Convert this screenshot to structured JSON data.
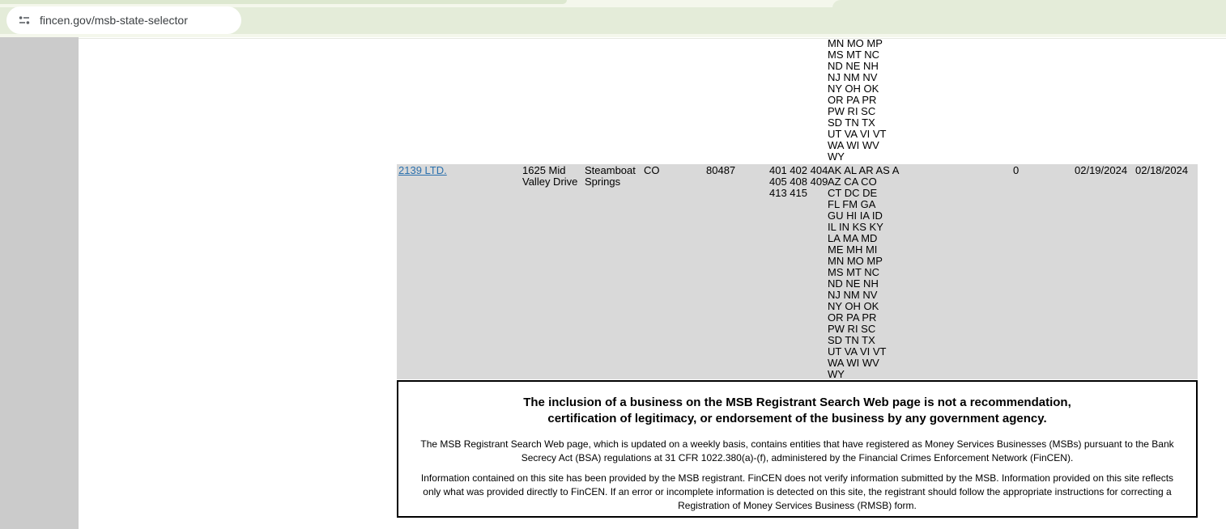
{
  "browser": {
    "url": "fincen.gov/msb-state-selector"
  },
  "colors": {
    "chrome_bar_cream": "#f4f7ec",
    "chrome_bar_green": "#e4ecd9",
    "side_gutter_gray": "#cbcbcb",
    "row_background_gray": "#d9d9d9",
    "link_blue": "#2a70ad"
  },
  "table": {
    "previous_row_states_overflow": "MN MO MP\nMS MT NC\nND NE NH\nNJ NM NV\nNY OH OK\nOR PA PR\nPW RI SC\nSD TN TX\nUT VA VI VT\nWA WI WV\nWY",
    "row": {
      "legal_name": "2139 LTD.",
      "address": "1625 Mid\nValley Drive",
      "city": "Steamboat\nSprings",
      "state": "CO",
      "zip": "80487",
      "msb_activities": "401 402 404\n405 408 409\n413 415",
      "states_of_activities": "AK AL AR AS A\nAZ CA CO\nCT DC DE\nFL FM GA\nGU HI IA ID\nIL IN KS KY\nLA MA MD\nME MH MI\nMN MO MP\nMS MT NC\nND NE NH\nNJ NM NV\nNY OH OK\nOR PA PR\nPW RI SC\nSD TN TX\nUT VA VI VT\nWA WI WV\nWY",
      "branch_count": "0",
      "date_1": "02/19/2024",
      "date_2": "02/18/2024"
    }
  },
  "disclaimer": {
    "heading": "The inclusion of a business on the MSB Registrant Search Web page is not a recommendation,\ncertification of legitimacy, or endorsement of the business by any government agency.",
    "paragraph1": "The MSB Registrant Search Web page, which is updated on a weekly basis, contains entities that have registered as Money Services Businesses (MSBs) pursuant to the Bank\nSecrecy Act (BSA) regulations at 31 CFR 1022.380(a)-(f), administered by the Financial Crimes Enforcement Network (FinCEN).",
    "paragraph2": "Information contained on this site has been provided by the MSB registrant. FinCEN does not verify information submitted by the MSB. Information provided on this site reflects\nonly what was provided directly to FinCEN. If an error or incomplete information is detected on this site, the registrant should follow the appropriate instructions for correcting a\nRegistration of Money Services Business (RMSB) form."
  }
}
